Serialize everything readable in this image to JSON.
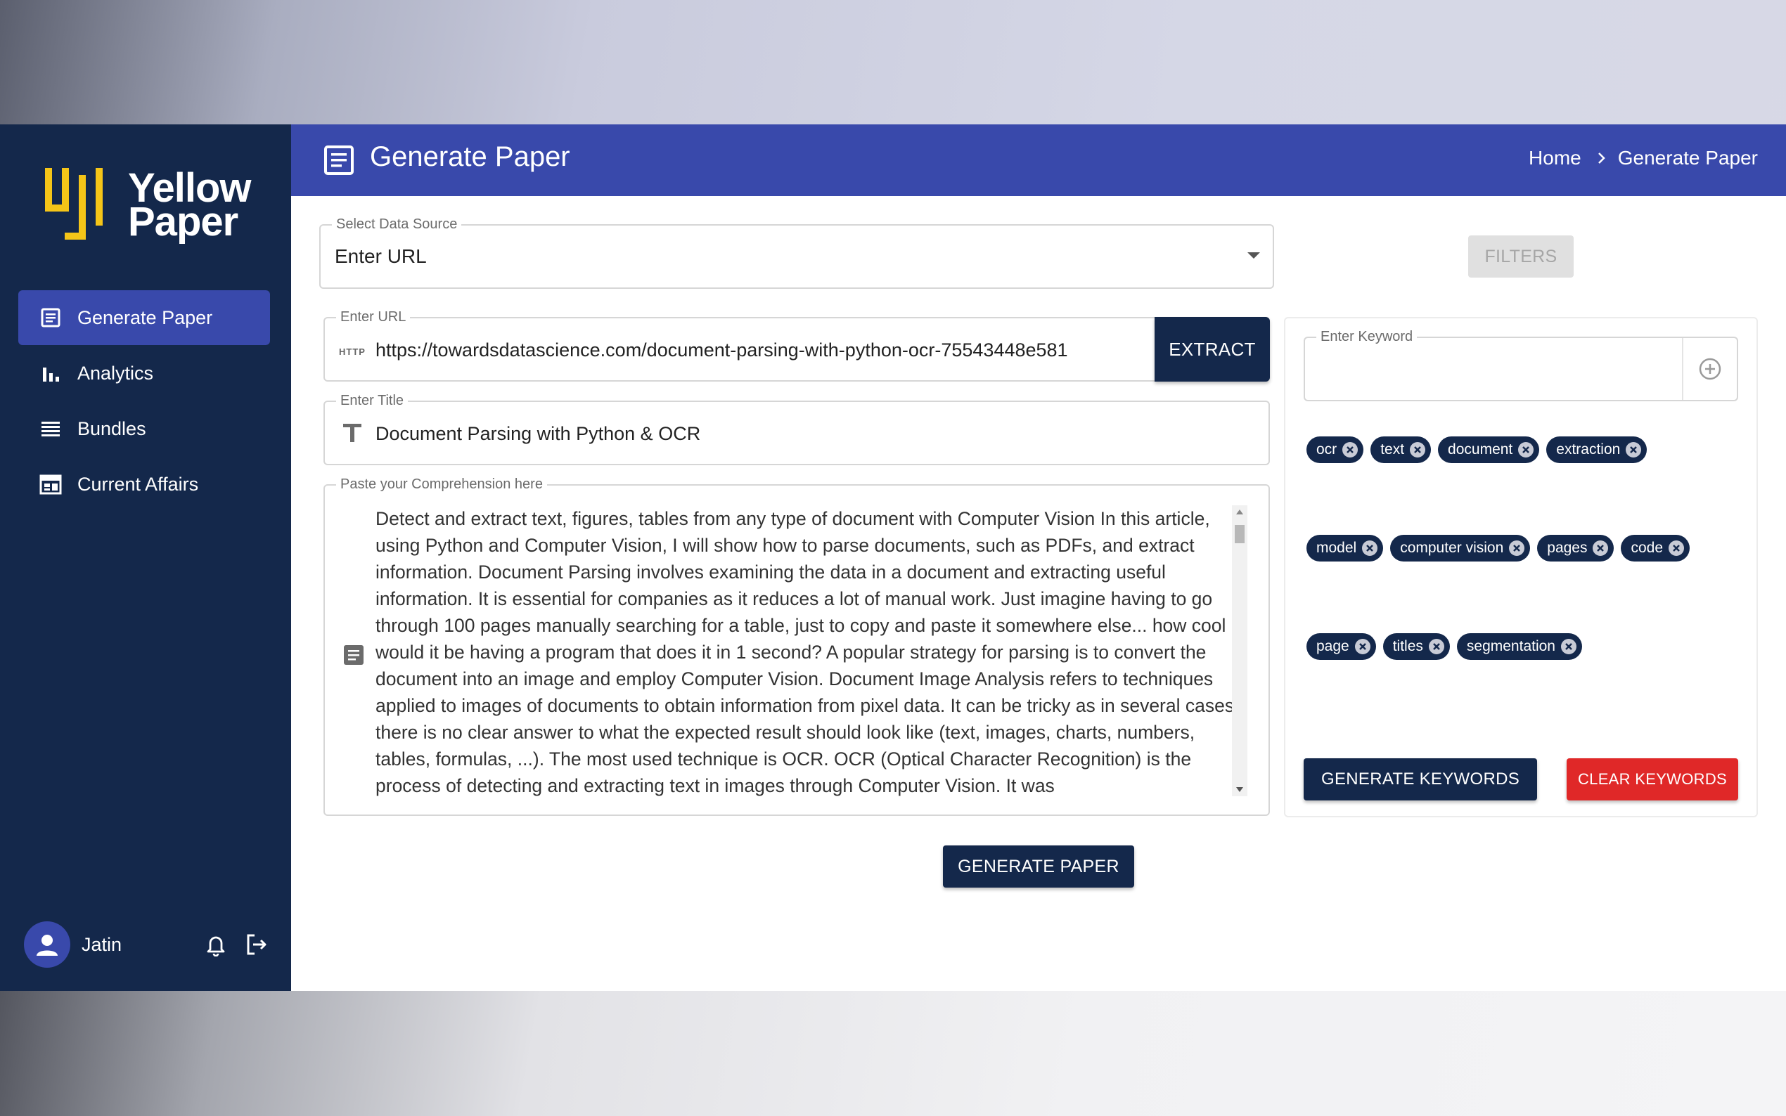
{
  "sidebar": {
    "logo_text_line1": "Yellow",
    "logo_text_line2": "Paper",
    "items": [
      {
        "label": "Generate Paper",
        "icon": "document-icon",
        "active": true
      },
      {
        "label": "Analytics",
        "icon": "bar-chart-icon",
        "active": false
      },
      {
        "label": "Bundles",
        "icon": "stack-icon",
        "active": false
      },
      {
        "label": "Current Affairs",
        "icon": "calendar-icon",
        "active": false
      }
    ],
    "user": {
      "name": "Jatin"
    }
  },
  "header": {
    "title": "Generate Paper",
    "breadcrumb": {
      "home": "Home",
      "current": "Generate Paper"
    }
  },
  "form": {
    "data_source": {
      "label": "Select Data Source",
      "value": "Enter URL"
    },
    "filters_button": "FILTERS",
    "url": {
      "label": "Enter URL",
      "prefix": "HTTP",
      "value": "https://towardsdatascience.com/document-parsing-with-python-ocr-75543448e581"
    },
    "extract_button": "EXTRACT",
    "title": {
      "label": "Enter Title",
      "value": "Document Parsing with Python & OCR"
    },
    "comprehension": {
      "label": "Paste your Comprehension here",
      "value": "Detect and extract text, figures, tables from any type of document with Computer Vision In this article, using Python and Computer Vision, I will show how to parse documents, such as PDFs, and extract information. Document Parsing involves examining the data in a document and extracting useful information. It is essential for companies as it reduces a lot of manual work. Just imagine having to go through 100 pages manually searching for a table, just to copy and paste it somewhere else... how cool would it be having a program that does it in 1 second? A popular strategy for parsing is to convert the document into an image and employ Computer Vision. Document Image Analysis refers to techniques applied to images of documents to obtain information from pixel data. It can be tricky as in several cases there is no clear answer to what the expected result should look like (text, images, charts, numbers, tables, formulas, ...). The most used technique is OCR. OCR (Optical Character Recognition) is the process of detecting and extracting text in images through Computer Vision. It was"
    },
    "generate_paper_button": "GENERATE PAPER"
  },
  "keywords": {
    "input_label": "Enter Keyword",
    "input_value": "",
    "rows": [
      [
        "ocr",
        "text",
        "document",
        "extraction"
      ],
      [
        "model",
        "computer vision",
        "pages",
        "code"
      ],
      [
        "page",
        "titles",
        "segmentation"
      ]
    ],
    "generate_button": "GENERATE KEYWORDS",
    "clear_button": "CLEAR KEYWORDS"
  },
  "colors": {
    "sidebar_bg": "#14284b",
    "header_bg": "#3949ab",
    "logo_yellow": "#f5c518",
    "danger": "#e02828"
  }
}
